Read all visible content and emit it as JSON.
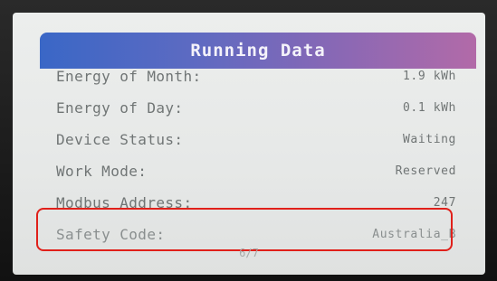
{
  "header": {
    "title": "Running Data"
  },
  "rows": [
    {
      "label": "Energy of Month:",
      "value": "1.9 kWh"
    },
    {
      "label": "Energy of Day:",
      "value": "0.1 kWh"
    },
    {
      "label": "Device Status:",
      "value": "Waiting"
    },
    {
      "label": "Work Mode:",
      "value": "Reserved"
    },
    {
      "label": "Modbus Address:",
      "value": "247"
    },
    {
      "label": "Safety Code:",
      "value": "Australia_B"
    }
  ],
  "footer": {
    "page": "6/7"
  },
  "colors": {
    "highlight_border": "#e0201a",
    "title_gradient_start": "#3a67c6",
    "title_gradient_end": "#b26aa8"
  }
}
